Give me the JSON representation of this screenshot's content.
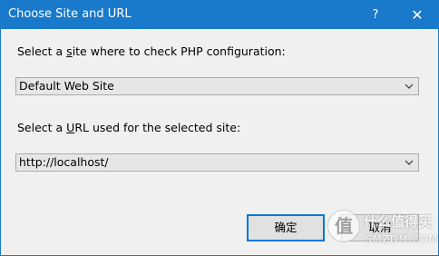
{
  "window": {
    "title": "Choose Site and URL",
    "help_label": "?",
    "close_label": "✕"
  },
  "site": {
    "label_before": "Select a ",
    "label_accel": "s",
    "label_after": "ite where to check PHP configuration:",
    "selected": "Default Web Site"
  },
  "url": {
    "label_before": "Select a ",
    "label_accel": "U",
    "label_after": "RL used for the selected site:",
    "selected": "http://localhost/"
  },
  "buttons": {
    "ok_label": "确定",
    "cancel_label": "取消"
  },
  "watermark": {
    "glyph": "值",
    "cn_text": "什么值得买",
    "en_text": "SMZDM.COM"
  },
  "colors": {
    "titlebar": "#1979ca",
    "background": "#f0f0f0",
    "focus_border": "#0078d7"
  },
  "icons": {
    "dropdown": "chevron-down-icon",
    "close": "close-icon",
    "help": "help-icon"
  }
}
